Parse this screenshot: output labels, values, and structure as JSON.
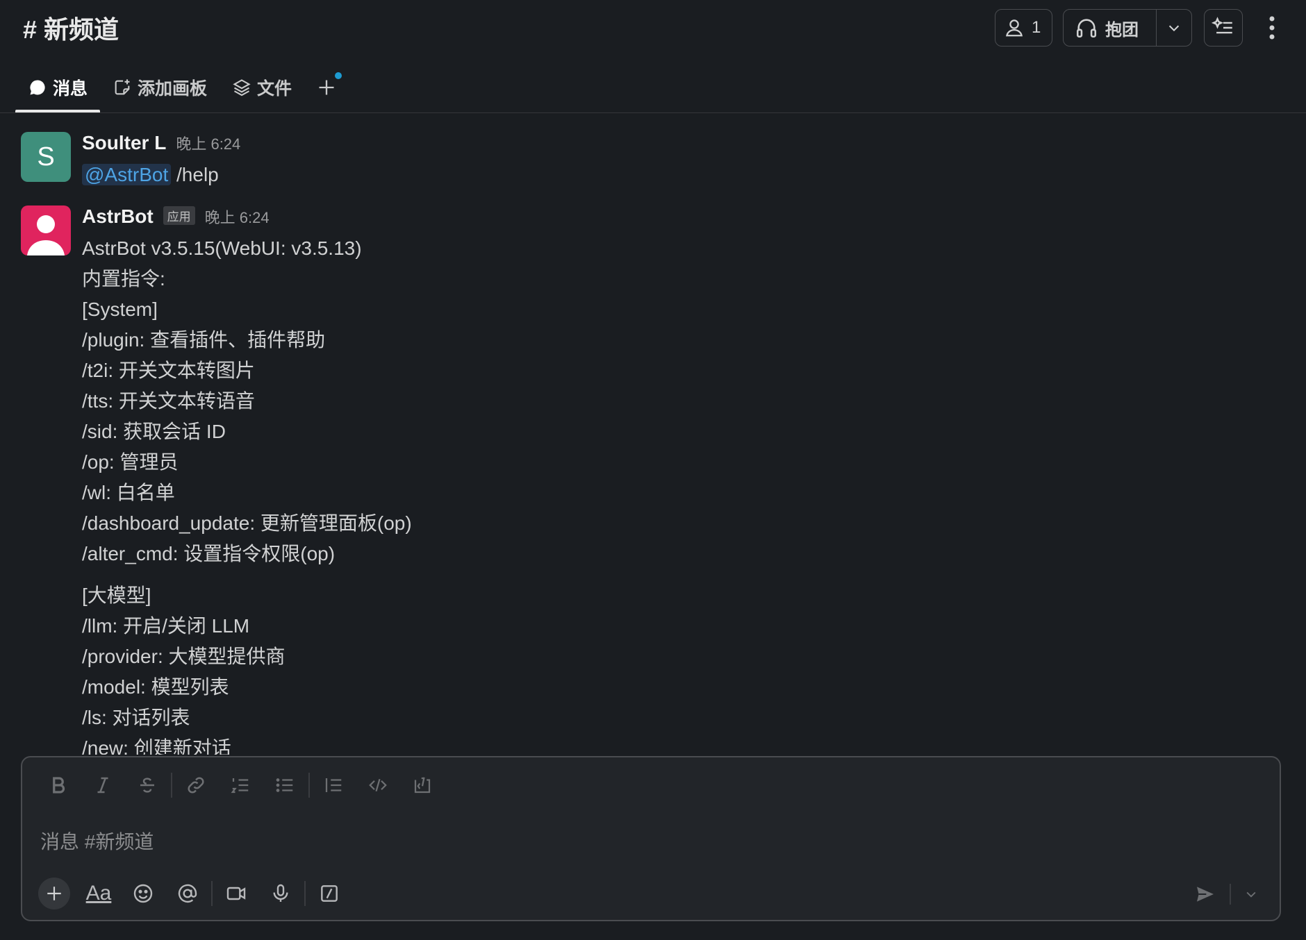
{
  "channel": {
    "title": "# 新频道"
  },
  "header": {
    "member_count": "1",
    "huddle_label": "抱团"
  },
  "tabs": [
    {
      "label": "消息"
    },
    {
      "label": "添加画板"
    },
    {
      "label": "文件"
    }
  ],
  "messages": [
    {
      "sender": "Soulter L",
      "time": "晚上 6:24",
      "avatar_letter": "S",
      "mention": "@AstrBot",
      "text": " /help"
    },
    {
      "sender": "AstrBot",
      "badge": "应用",
      "time": "晚上 6:24",
      "lines_a": [
        "AstrBot v3.5.15(WebUI: v3.5.13)",
        "内置指令:",
        "[System]",
        "/plugin: 查看插件、插件帮助",
        "/t2i: 开关文本转图片",
        "/tts: 开关文本转语音",
        "/sid: 获取会话 ID",
        "/op: 管理员",
        "/wl: 白名单",
        "/dashboard_update: 更新管理面板(op)",
        "/alter_cmd: 设置指令权限(op)"
      ],
      "lines_b": [
        "[大模型]",
        "/llm: 开启/关闭 LLM",
        "/provider: 大模型提供商",
        "/model: 模型列表",
        "/ls: 对话列表",
        "/new: 创建新对话"
      ]
    }
  ],
  "composer": {
    "placeholder": "消息 #新频道",
    "format_label": "Aa"
  },
  "colors": {
    "background": "#1a1d21",
    "accent_blue": "#1d9bd1",
    "mention": "#4ea4e5",
    "avatar_s": "#3f8f7c",
    "avatar_bot": "#e0245e"
  }
}
